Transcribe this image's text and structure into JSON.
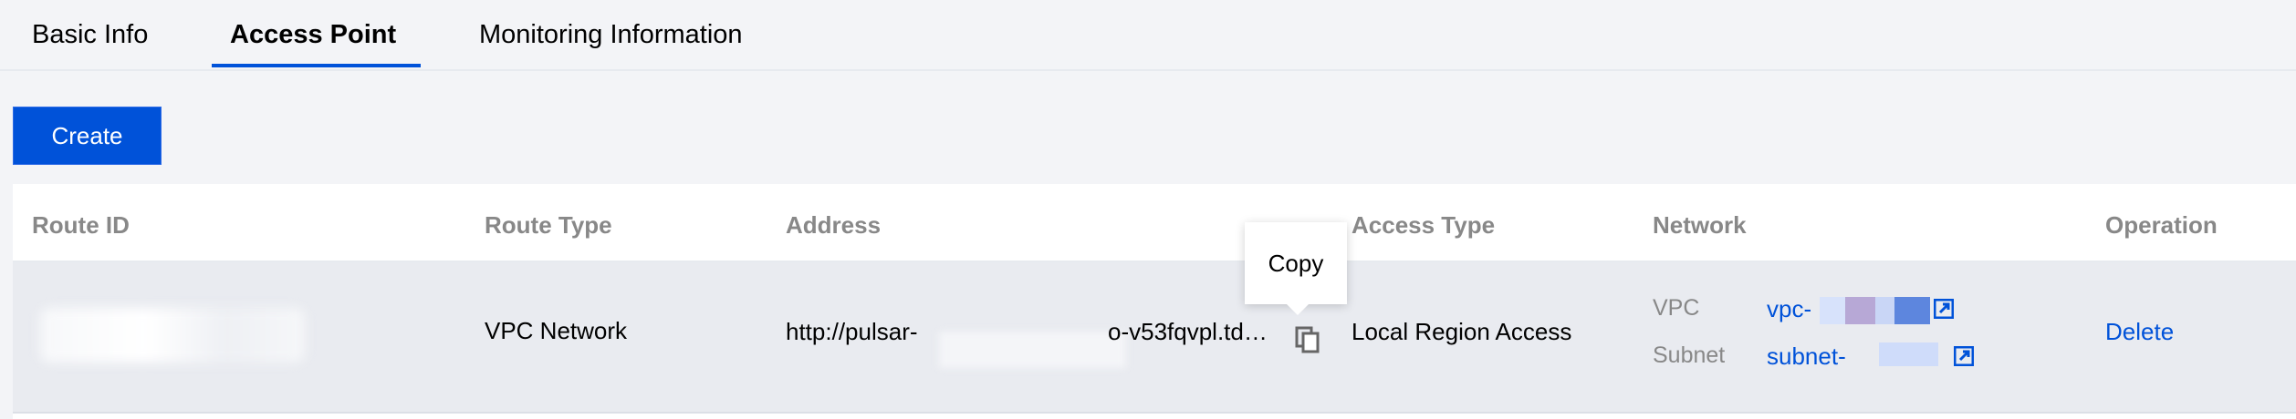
{
  "tabs": [
    {
      "label": "Basic Info"
    },
    {
      "label": "Access Point"
    },
    {
      "label": "Monitoring Information"
    }
  ],
  "active_tab": "Access Point",
  "create_button": {
    "label": "Create"
  },
  "table": {
    "columns": [
      "Route ID",
      "Route Type",
      "Address",
      "Access Type",
      "Network",
      "Operation"
    ],
    "rows": [
      {
        "route_type": "VPC Network",
        "address_start": "http://pulsar-",
        "address_end": "o-v53fqvpl.td…",
        "access_type": "Local Region Access",
        "network": {
          "vpc_label": "VPC",
          "vpc_value": "vpc-",
          "subnet_label": "Subnet",
          "subnet_value": "subnet-"
        },
        "operation": "Delete"
      }
    ]
  },
  "tooltip": {
    "text": "Copy"
  },
  "colors": {
    "accent": "#0052d9",
    "header_text": "#888888",
    "row_bg": "#e9ebf0"
  }
}
